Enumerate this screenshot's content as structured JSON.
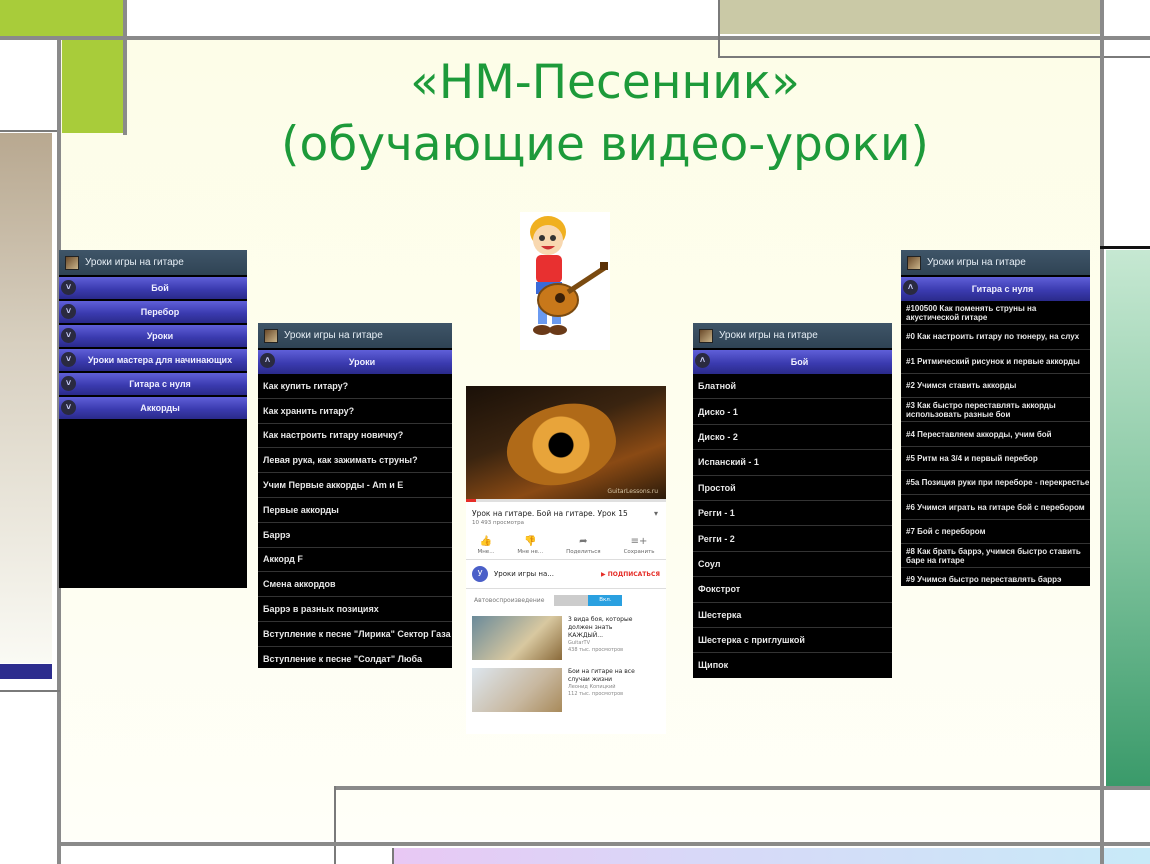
{
  "title": {
    "line1": "«НМ-Песенник»",
    "line2": "(обучающие видео-уроки)"
  },
  "screen1": {
    "app_title": "Уроки игры на гитаре",
    "groups": [
      "Бой",
      "Перебор",
      "Уроки",
      "Уроки мастера для начинающих",
      "Гитара с нуля",
      "Аккорды"
    ]
  },
  "screen2": {
    "app_title": "Уроки игры на гитаре",
    "group": "Уроки",
    "items": [
      "Как купить гитару?",
      "Как хранить гитару?",
      "Как настроить гитару новичку?",
      "Левая рука, как зажимать струны?",
      "Учим Первые аккорды - Am и E",
      "Первые аккорды",
      "Баррэ",
      "Аккорд F",
      "Смена аккордов",
      "Баррэ в разных позициях",
      "Вступление к песне \"Лирика\" Сектор Газа",
      "Вступление к песне \"Солдат\" Люба"
    ]
  },
  "youtube": {
    "watermark": "GuitarLessons.ru",
    "video_title": "Урок на гитаре. Бой на гитаре. Урок 15",
    "views": "10 493 просмотра",
    "actions": [
      "Мне...",
      "Мне не...",
      "Поделиться",
      "Сохранить"
    ],
    "channel_name": "Уроки игры на...",
    "subscribe": "ПОДПИСАТЬСЯ",
    "autoplay_label": "Автовоспроизведение",
    "autoplay_state": "Вкл.",
    "related": [
      {
        "title": "3 вида боя, которые должен знать КАЖДЫЙ...",
        "channel": "GuitarTV",
        "views": "438 тыс. просмотров"
      },
      {
        "title": "Бои на гитаре на все случаи жизни",
        "channel": "Леонид Копицкий",
        "views": "112 тыс. просмотров"
      }
    ]
  },
  "screen4": {
    "app_title": "Уроки игры на гитаре",
    "group": "Бой",
    "items": [
      "Блатной",
      "Диско - 1",
      "Диско - 2",
      "Испанский - 1",
      "Простой",
      "Регги - 1",
      "Регги - 2",
      "Соул",
      "Фокстрот",
      "Шестерка",
      "Шестерка с приглушкой",
      "Щипок"
    ]
  },
  "screen5": {
    "app_title": "Уроки игры на гитаре",
    "group": "Гитара с нуля",
    "items": [
      "#100500 Как поменять струны на акустической гитаре",
      "#0 Как настроить гитару по тюнеру, на слух",
      "#1 Ритмический рисунок и первые аккорды",
      "#2 Учимся ставить аккорды",
      "#3 Как быстро переставлять аккорды использовать разные бои",
      "#4 Переставляем аккорды, учим бой",
      "#5 Ритм на 3/4 и первый перебор",
      "#5а Позиция руки при переборе - перекрестье",
      "#6 Учимся играть на гитаре бой с перебором",
      "#7 Бой с перебором",
      "#8 Как брать баррэ, учимся быстро ставить баре на гитаре",
      "#9 Учимся быстро переставлять баррэ"
    ]
  },
  "colors": {
    "title": "#1d9a3a",
    "group_button": "#3b3bb0",
    "list_text_accent": "#9fd8ff"
  }
}
